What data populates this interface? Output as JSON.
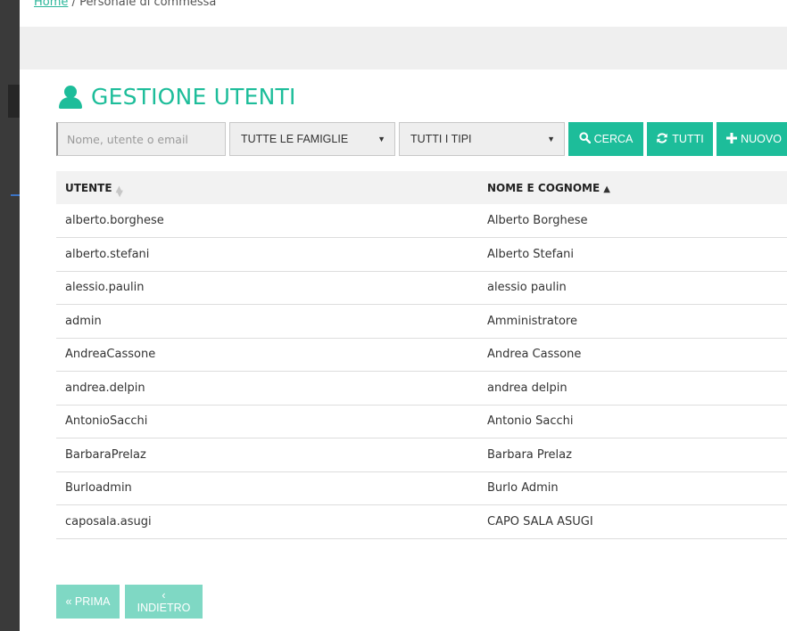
{
  "breadcrumb": {
    "home": "Home",
    "separator": "/",
    "current": "Personale di commessa"
  },
  "page": {
    "title": "GESTIONE UTENTI",
    "icon": "user-icon"
  },
  "toolbar": {
    "search_placeholder": "Nome, utente o email",
    "search_value": "",
    "family_select": "TUTTE LE FAMIGLIE",
    "type_select": "TUTTI I TIPI",
    "cerca_label": "CERCA",
    "tutti_label": "TUTTI",
    "nuovo_label": "NUOVO",
    "cerca_icon": "search-icon",
    "tutti_icon": "refresh-icon",
    "nuovo_icon": "plus-icon"
  },
  "table": {
    "headers": [
      "UTENTE",
      "NOME E COGNOME"
    ],
    "rows": [
      [
        "alberto.borghese",
        "Alberto Borghese"
      ],
      [
        "alberto.stefani",
        "Alberto Stefani"
      ],
      [
        "alessio.paulin",
        "alessio paulin"
      ],
      [
        "admin",
        "Amministratore"
      ],
      [
        "AndreaCassone",
        "Andrea Cassone"
      ],
      [
        "andrea.delpin",
        "andrea delpin"
      ],
      [
        "AntonioSacchi",
        "Antonio Sacchi"
      ],
      [
        "BarbaraPrelaz",
        "Barbara Prelaz"
      ],
      [
        "Burloadmin",
        "Burlo Admin"
      ],
      [
        "caposala.asugi",
        "CAPO SALA ASUGI"
      ]
    ]
  },
  "pager": {
    "prima_label": "« PRIMA",
    "indietro_label": "‹ INDIETRO"
  },
  "colors": {
    "accent": "#1dbd9a",
    "accent_disabled": "#7fd8c4",
    "header_bg": "#f2f2f2",
    "band_bg": "#efefef"
  }
}
